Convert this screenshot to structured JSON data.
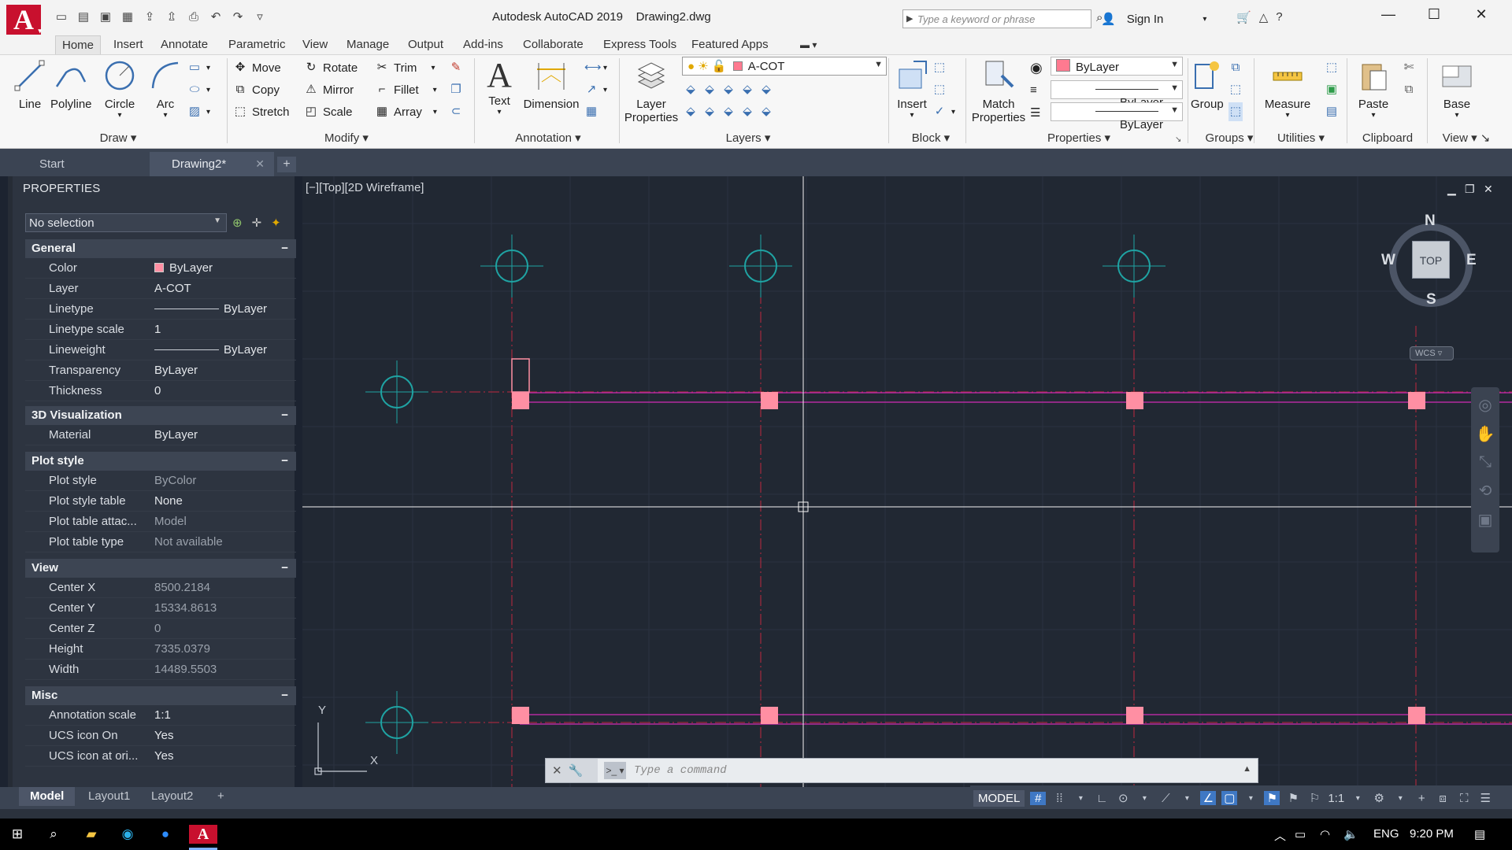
{
  "window": {
    "app_title": "Autodesk AutoCAD 2019",
    "file_name": "Drawing2.dwg",
    "search_placeholder": "Type a keyword or phrase",
    "sign_in": "Sign In"
  },
  "ribbon_tabs": [
    "Home",
    "Insert",
    "Annotate",
    "Parametric",
    "View",
    "Manage",
    "Output",
    "Add-ins",
    "Collaborate",
    "Express Tools",
    "Featured Apps"
  ],
  "ribbon": {
    "draw": {
      "line": "Line",
      "polyline": "Polyline",
      "circle": "Circle",
      "arc": "Arc",
      "title": "Draw"
    },
    "modify": {
      "move": "Move",
      "rotate": "Rotate",
      "trim": "Trim",
      "copy": "Copy",
      "mirror": "Mirror",
      "fillet": "Fillet",
      "stretch": "Stretch",
      "scale": "Scale",
      "array": "Array",
      "title": "Modify"
    },
    "annotation": {
      "text": "Text",
      "dimension": "Dimension",
      "title": "Annotation"
    },
    "layers": {
      "layer_properties_1": "Layer",
      "layer_properties_2": "Properties",
      "current_layer": "A-COT",
      "title": "Layers"
    },
    "block": {
      "insert": "Insert",
      "title": "Block"
    },
    "properties": {
      "match_1": "Match",
      "match_2": "Properties",
      "color": "ByLayer",
      "lineweight": "ByLayer",
      "linetype": "ByLayer",
      "title": "Properties"
    },
    "groups": {
      "group": "Group",
      "title": "Groups"
    },
    "utilities": {
      "measure": "Measure",
      "title": "Utilities"
    },
    "clipboard": {
      "paste": "Paste",
      "title": "Clipboard"
    },
    "view": {
      "base": "Base",
      "title": "View"
    }
  },
  "file_tabs": {
    "start": "Start",
    "drawing": "Drawing2*"
  },
  "properties": {
    "header": "PROPERTIES",
    "selection": "No selection",
    "sections": {
      "general": "General",
      "visualization": "3D Visualization",
      "plot": "Plot style",
      "view": "View",
      "misc": "Misc"
    },
    "general": [
      {
        "k": "Color",
        "v": "ByLayer"
      },
      {
        "k": "Layer",
        "v": "A-COT"
      },
      {
        "k": "Linetype",
        "v": "ByLayer"
      },
      {
        "k": "Linetype scale",
        "v": "1"
      },
      {
        "k": "Lineweight",
        "v": "ByLayer"
      },
      {
        "k": "Transparency",
        "v": "ByLayer"
      },
      {
        "k": "Thickness",
        "v": "0"
      }
    ],
    "visualization": [
      {
        "k": "Material",
        "v": "ByLayer"
      }
    ],
    "plot": [
      {
        "k": "Plot style",
        "v": "ByColor"
      },
      {
        "k": "Plot style table",
        "v": "None"
      },
      {
        "k": "Plot table attac...",
        "v": "Model"
      },
      {
        "k": "Plot table type",
        "v": "Not available"
      }
    ],
    "view": [
      {
        "k": "Center X",
        "v": "8500.2184"
      },
      {
        "k": "Center Y",
        "v": "15334.8613"
      },
      {
        "k": "Center Z",
        "v": "0"
      },
      {
        "k": "Height",
        "v": "7335.0379"
      },
      {
        "k": "Width",
        "v": "14489.5503"
      }
    ],
    "misc": [
      {
        "k": "Annotation scale",
        "v": "1:1"
      },
      {
        "k": "UCS icon On",
        "v": "Yes"
      },
      {
        "k": "UCS icon at ori...",
        "v": "Yes"
      }
    ]
  },
  "viewport": {
    "label": "[−][Top][2D Wireframe]",
    "viewcube": {
      "n": "N",
      "s": "S",
      "e": "E",
      "w": "W",
      "face": "TOP",
      "wcs": "WCS"
    },
    "ucs": {
      "x": "X",
      "y": "Y"
    }
  },
  "command": {
    "placeholder": "Type  a  command"
  },
  "layout_tabs": [
    "Model",
    "Layout1",
    "Layout2"
  ],
  "status": {
    "model": "MODEL",
    "scale": "1:1"
  },
  "taskbar": {
    "lang": "ENG",
    "time": "9:20 PM"
  },
  "colors": {
    "grid_axis": "#ff3355",
    "column": "#ff8fa3",
    "beam": "#cc33aa",
    "bubble": "#1fa3a3"
  }
}
